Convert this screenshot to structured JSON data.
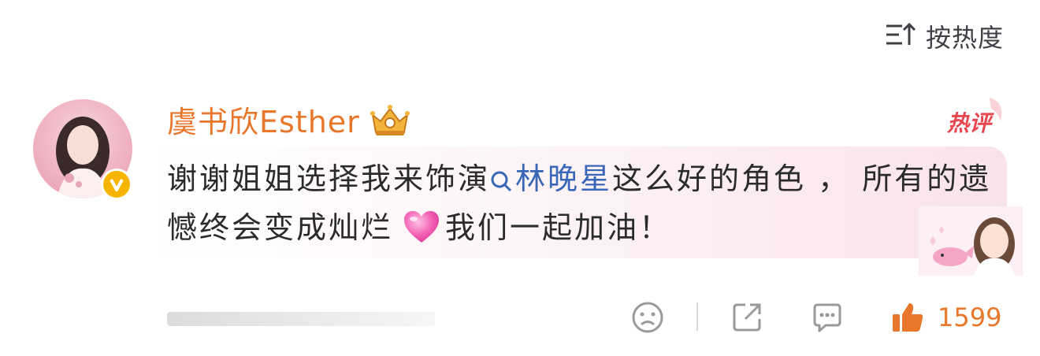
{
  "sort": {
    "label": "按热度",
    "icon": "sort-lines-arrow-icon"
  },
  "comment": {
    "username": "虞书欣Esther",
    "badge": "crown-vip-icon",
    "verified_icon": "verified-v-badge",
    "hot_label": "热评",
    "text_part1": "谢谢姐姐选择我来饰演",
    "topic": "林晚星",
    "text_part2": "这么好的角色 ， 所有的遗憾终会变成灿烂",
    "emoji": "pink-heart-emoji",
    "text_part3": "我们一起加油！"
  },
  "actions": {
    "emoji_icon": "sad-face-icon",
    "share_icon": "share-icon",
    "reply_icon": "comment-bubble-icon",
    "like_icon": "thumbs-up-icon",
    "like_count": "1599"
  },
  "colors": {
    "username": "#e8772b",
    "topic": "#3a66b8",
    "like": "#e8772b",
    "verified": "#f7b500",
    "hot": "#e8474f"
  }
}
